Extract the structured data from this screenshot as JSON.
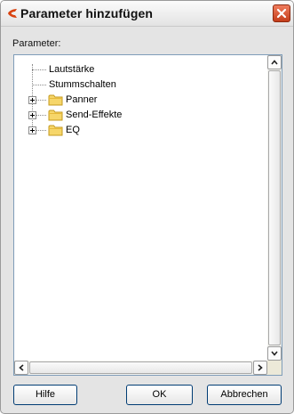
{
  "dialog": {
    "title": "Parameter hinzufügen",
    "logo_icon": "cubase-logo-icon",
    "close_icon": "close-icon"
  },
  "tree": {
    "label": "Parameter:",
    "items": [
      {
        "label": "Lautstärke",
        "type": "leaf"
      },
      {
        "label": "Stummschalten",
        "type": "leaf"
      },
      {
        "label": "Panner",
        "type": "folder",
        "icon": "folder-icon"
      },
      {
        "label": "Send-Effekte",
        "type": "folder",
        "icon": "folder-icon"
      },
      {
        "label": "EQ",
        "type": "folder",
        "icon": "folder-icon"
      }
    ]
  },
  "buttons": {
    "help": "Hilfe",
    "ok": "OK",
    "cancel": "Abbrechen"
  },
  "colors": {
    "accent": "#d9420f",
    "folder": "#f6d66a",
    "panel_border": "#7f9db9"
  }
}
